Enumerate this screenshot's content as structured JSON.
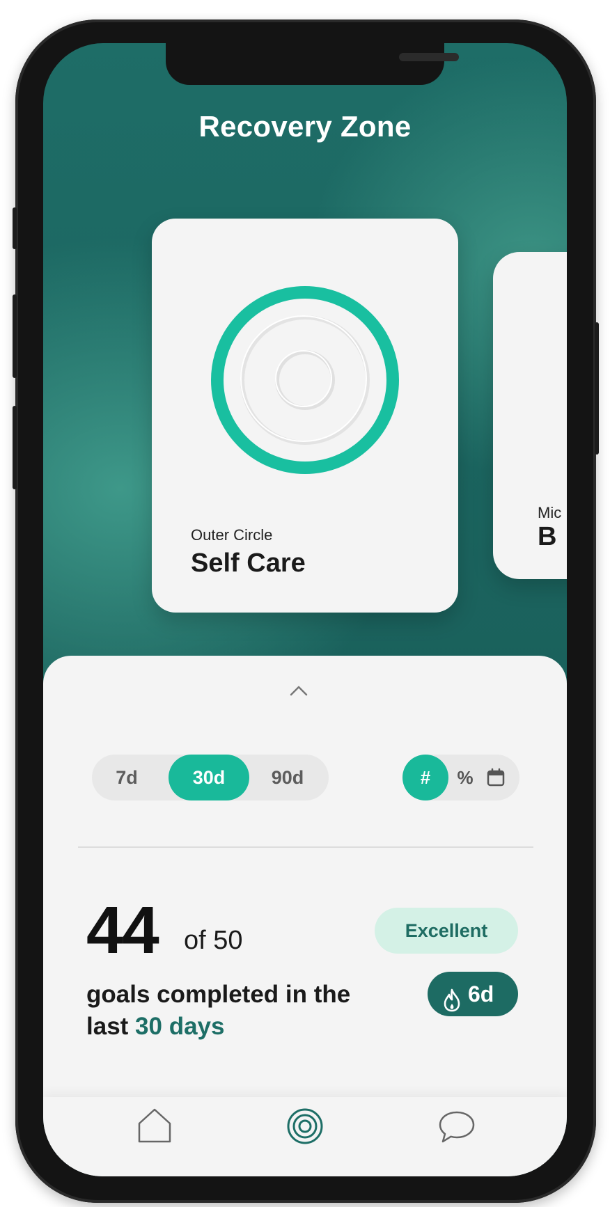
{
  "header": {
    "title": "Recovery Zone"
  },
  "cards": [
    {
      "subtitle": "Outer Circle",
      "name": "Self Care"
    },
    {
      "subtitle": "Mic",
      "name": "B"
    }
  ],
  "filters": {
    "periods": [
      "7d",
      "30d",
      "90d"
    ],
    "selected_period": "30d",
    "modes": [
      {
        "icon": "hash",
        "label": "#",
        "selected": true
      },
      {
        "icon": "percent",
        "label": "%",
        "selected": false
      },
      {
        "icon": "calendar-icon",
        "label": "",
        "selected": false
      }
    ]
  },
  "stats": {
    "completed": "44",
    "of_total": "of 50",
    "goals_text": "goals completed in the last",
    "goals_highlight": "30 days",
    "rating": "Excellent",
    "streak": "6d"
  },
  "tabbar": {
    "items": [
      {
        "icon": "home-icon",
        "selected": false
      },
      {
        "icon": "circles-icon",
        "selected": true
      },
      {
        "icon": "chat-icon",
        "selected": false
      }
    ]
  },
  "colors": {
    "accent": "#19b99a",
    "dark_teal": "#1d6b63",
    "background_teal": "#1e6d67",
    "badge_light": "#d4f1e6"
  }
}
